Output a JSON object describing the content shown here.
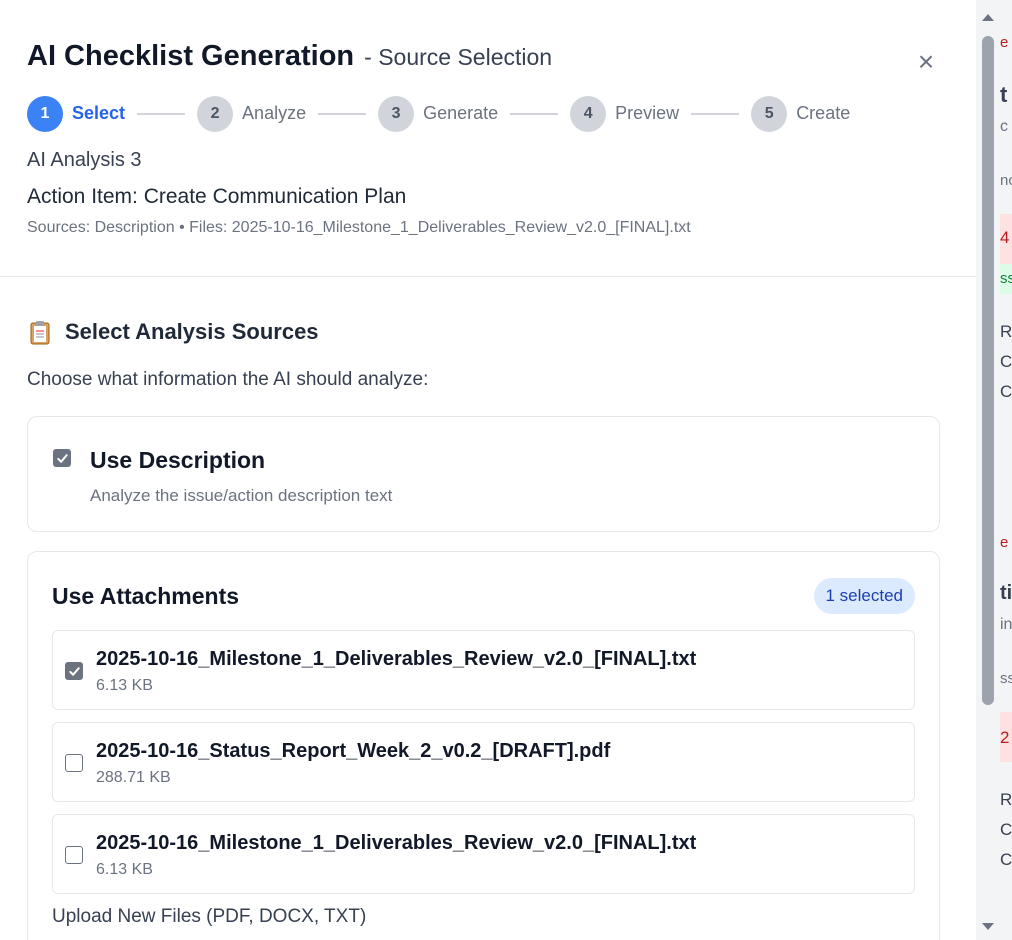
{
  "modal": {
    "title": "AI Checklist Generation",
    "subtitle": "- Source Selection",
    "close_icon": "×",
    "steps": [
      {
        "num": "1",
        "label": "Select",
        "active": true
      },
      {
        "num": "2",
        "label": "Analyze",
        "active": false
      },
      {
        "num": "3",
        "label": "Generate",
        "active": false
      },
      {
        "num": "4",
        "label": "Preview",
        "active": false
      },
      {
        "num": "5",
        "label": "Create",
        "active": false
      }
    ],
    "analysis_name": "AI Analysis 3",
    "action_item": "Action Item: Create Communication Plan",
    "sources_summary": "Sources: Description • Files: 2025-10-16_Milestone_1_Deliverables_Review_v2.0_[FINAL].txt"
  },
  "sources": {
    "title": "Select Analysis Sources",
    "icon": "clipboard-icon",
    "instructions": "Choose what information the AI should analyze:",
    "description_option": {
      "label": "Use Description",
      "sub": "Analyze the issue/action description text",
      "checked": true
    },
    "attachments": {
      "title": "Use Attachments",
      "badge": "1 selected",
      "files": [
        {
          "name": "2025-10-16_Milestone_1_Deliverables_Review_v2.0_[FINAL].txt",
          "size": "6.13 KB",
          "checked": true
        },
        {
          "name": "2025-10-16_Status_Report_Week_2_v0.2_[DRAFT].pdf",
          "size": "288.71 KB",
          "checked": false
        },
        {
          "name": "2025-10-16_Milestone_1_Deliverables_Review_v2.0_[FINAL].txt",
          "size": "6.13 KB",
          "checked": false
        }
      ],
      "upload_label": "Upload New Files (PDF, DOCX, TXT)"
    }
  },
  "background": {
    "fragments": [
      "e",
      "t",
      "c",
      "nc",
      "4",
      "ss",
      "Re",
      "Co",
      "Co",
      "e",
      "ti",
      "in",
      "ss",
      "2",
      "Re",
      "Co",
      "Co"
    ]
  },
  "colors": {
    "accent": "#3b82f6",
    "badge_bg": "#dbeafe",
    "badge_text": "#1e40af",
    "checked": "#6b7280"
  }
}
